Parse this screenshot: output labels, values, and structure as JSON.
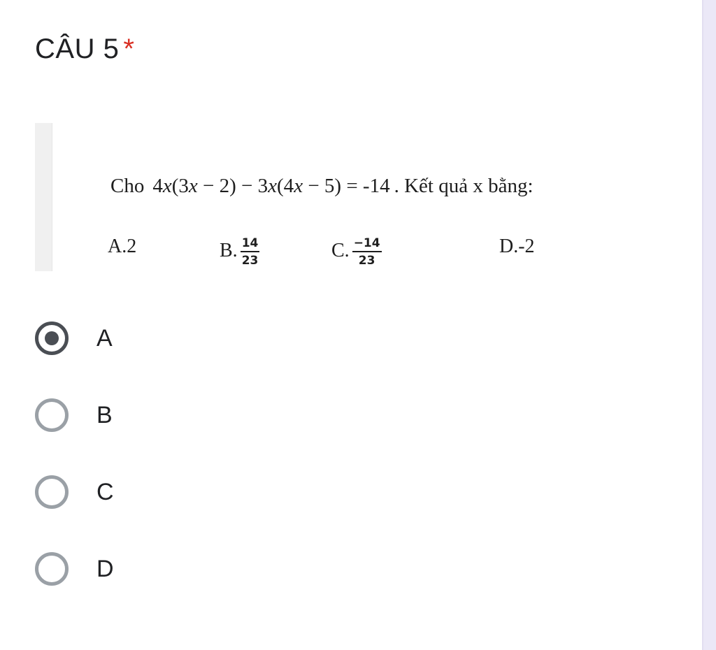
{
  "question": {
    "title": "CÂU 5",
    "required_marker": "*",
    "image": {
      "problem_prefix": "Cho",
      "equation": {
        "a": "4",
        "x1": "x",
        "inner1": "(3",
        "x2": "x",
        "rest1": " − 2) − 3",
        "x3": "x",
        "inner2": "(4",
        "x4": "x",
        "rest2": " − 5) = -14"
      },
      "problem_suffix": ". Kết quả x bằng:",
      "answers": [
        {
          "label": "A.2"
        },
        {
          "label": "B.",
          "numerator": "14",
          "denominator": "23"
        },
        {
          "label": "C.",
          "numerator": "−14",
          "denominator": "23"
        },
        {
          "label": "D.-2"
        }
      ]
    },
    "options": [
      {
        "label": "A",
        "selected": true
      },
      {
        "label": "B",
        "selected": false
      },
      {
        "label": "C",
        "selected": false
      },
      {
        "label": "D",
        "selected": false
      }
    ]
  },
  "colors": {
    "required_star": "#d93025",
    "radio_selected": "#4a4e54",
    "radio_unselected": "#9aa0a6",
    "side_rail": "#ebe8f7"
  }
}
